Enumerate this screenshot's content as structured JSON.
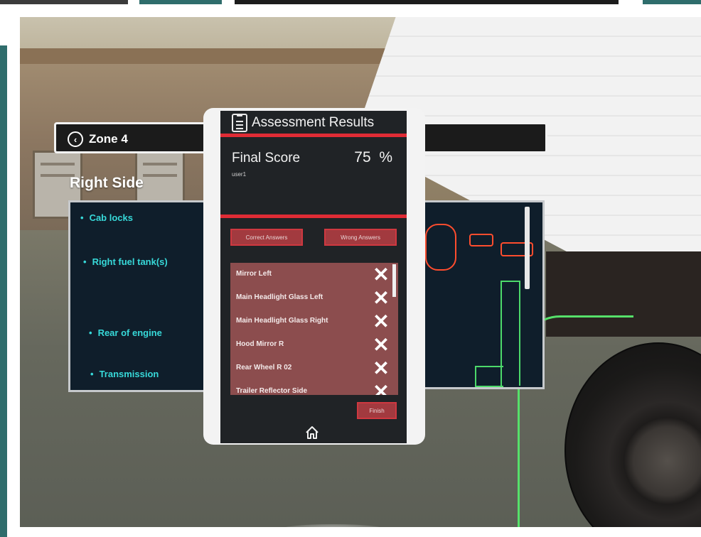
{
  "zone": {
    "title": "Zone 4"
  },
  "side": {
    "heading": "Right Side"
  },
  "checklist": {
    "items": [
      {
        "label": "Cab locks"
      },
      {
        "label": "Right fuel tank(s)"
      },
      {
        "label": "Rear of engine"
      },
      {
        "label": "Transmission"
      }
    ]
  },
  "modal": {
    "title": "Assessment Results",
    "score_label": "Final Score",
    "score_value": "75",
    "score_unit": "%",
    "user": "user1",
    "correct_label": "Correct  Answers",
    "wrong_label": "Wrong Answers",
    "answers": [
      {
        "label": "Mirror Left",
        "mark": "✕"
      },
      {
        "label": "Main Headlight Glass Left",
        "mark": "✕"
      },
      {
        "label": "Main Headlight Glass Right",
        "mark": "✕"
      },
      {
        "label": "Hood Mirror R",
        "mark": "✕"
      },
      {
        "label": "Rear Wheel R 02",
        "mark": "✕"
      },
      {
        "label": "Trailer Reflector Side",
        "mark": "✕"
      }
    ],
    "finish_label": "Finish"
  },
  "icons": {
    "back": "chevron-left-circle-icon",
    "clipboard": "clipboard-icon",
    "home": "home-icon",
    "wrong": "x-icon"
  },
  "colors": {
    "accent_red": "#e02c35",
    "button_red": "#a23a3f",
    "list_bg": "#8c4d4e",
    "checklist_text": "#37d9d9",
    "outline_green": "#4cd96a",
    "panel_bg": "#202326"
  }
}
